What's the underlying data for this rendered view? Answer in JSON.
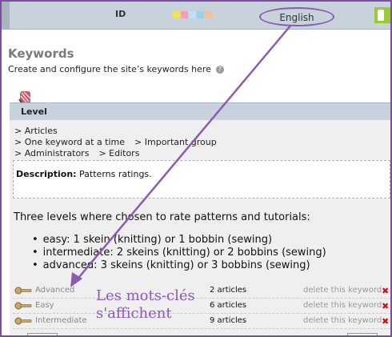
{
  "topbar": {
    "id_label": "ID",
    "language": "English",
    "swatches": [
      "#f0e060",
      "#f0a0c0",
      "#c0e0f0",
      "#a0d0e0",
      "#f0c0a0"
    ]
  },
  "page": {
    "title": "Keywords",
    "subtitle": "Create and configure the site’s keywords here",
    "help_glyph": "?"
  },
  "level": {
    "label": "Level",
    "breadcrumbs": [
      [
        "> Articles"
      ],
      [
        "> One keyword at a time",
        "> Important group"
      ],
      [
        "> Administrators",
        "> Editors"
      ]
    ],
    "description_label": "Description:",
    "description_text": "Patterns ratings."
  },
  "content": {
    "intro": "Three levels where chosen to rate patterns and tutorials:",
    "levels": [
      "easy: 1 skein (knitting) or 1 bobbin (sewing)",
      "intermediate: 2 skeins (knitting) or 2 bobbins (sewing)",
      "advanced: 3 skeins (knitting) or 3 bobbins (sewing)"
    ]
  },
  "keywords": [
    {
      "name": "Advanced",
      "count": "2 articles",
      "delete_label": "delete this keyword"
    },
    {
      "name": "Easy",
      "count": "6 articles",
      "delete_label": "delete this keyword"
    },
    {
      "name": "Intermediate",
      "count": "9 articles",
      "delete_label": "delete this keyword"
    }
  ],
  "annotation": {
    "line1": "Les mots-clés",
    "line2": "s'affichent",
    "color": "#8a5bb0"
  }
}
